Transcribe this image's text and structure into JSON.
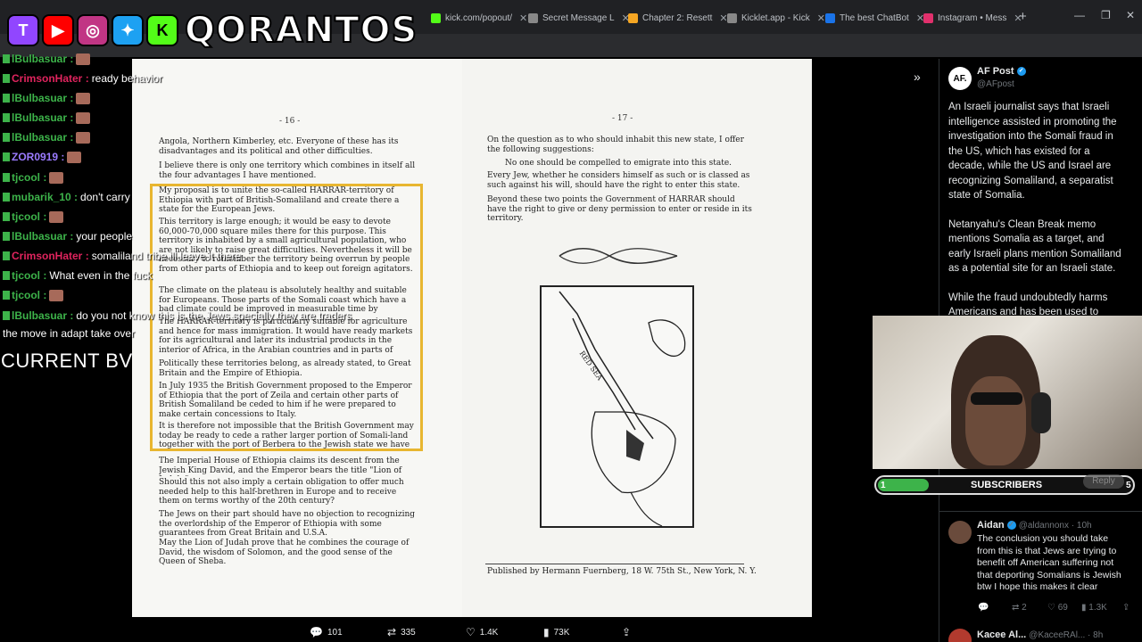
{
  "browser": {
    "tabs": [
      {
        "title": "kick.com/popout/",
        "color": "#53fc18"
      },
      {
        "title": "Secret Message L",
        "color": "#888888"
      },
      {
        "title": "Chapter 2: Resett",
        "color": "#f5a623"
      },
      {
        "title": "Kicklet.app - Kick",
        "color": "#888888"
      },
      {
        "title": "The best ChatBot",
        "color": "#1a73e8"
      },
      {
        "title": "Instagram • Mess",
        "color": "#e1306c"
      }
    ]
  },
  "overlay": {
    "logo_text": "QORANTOS",
    "logo_icons": [
      "twitch-icon",
      "youtube-icon",
      "instagram-icon",
      "twitter-icon",
      "kick-icon"
    ],
    "current_label": "CURRENT BV"
  },
  "chat": [
    {
      "user": "lBulbasuar :",
      "msg": "",
      "color": "#3db34a",
      "emote": true
    },
    {
      "user": "CrimsonHater :",
      "msg": "ready behavior",
      "color": "#e0245e",
      "emote": false
    },
    {
      "user": "lBulbasuar :",
      "msg": "",
      "color": "#3db34a",
      "emote": true
    },
    {
      "user": "lBulbasuar :",
      "msg": "",
      "color": "#3db34a",
      "emote": true
    },
    {
      "user": "lBulbasuar :",
      "msg": "",
      "color": "#3db34a",
      "emote": true
    },
    {
      "user": "ZOR0919 :",
      "msg": "",
      "color": "#9b7bff",
      "emote": true
    },
    {
      "user": "tjcool :",
      "msg": "",
      "color": "#3db34a",
      "emote": true
    },
    {
      "user": "mubarik_10 :",
      "msg": "don't carry",
      "color": "#3db34a",
      "emote": false
    },
    {
      "user": "tjcool :",
      "msg": "",
      "color": "#3db34a",
      "emote": true
    },
    {
      "user": "lBulbasuar :",
      "msg": "your people",
      "color": "#3db34a",
      "emote": false
    },
    {
      "user": "CrimsonHater :",
      "msg": "somaliland tribe ill leave it there",
      "color": "#e0245e",
      "emote": false
    },
    {
      "user": "tjcool :",
      "msg": "What even in the fuck",
      "color": "#3db34a",
      "emote": false
    },
    {
      "user": "tjcool :",
      "msg": "",
      "color": "#3db34a",
      "emote": true
    },
    {
      "user": "lBulbasuar :",
      "msg": "do you not know this is the Jews specially they are traders",
      "color": "#3db34a",
      "emote": false
    },
    {
      "user": "",
      "msg": "the move in adapt take over",
      "color": "#ffffff",
      "emote": false
    }
  ],
  "document": {
    "left_page_number": "- 16 -",
    "right_page_number": "- 17 -",
    "left_paragraphs": [
      "Angola, Northern Kimberley, etc. Everyone of these has its disadvantages and its political and other difficulties.",
      "I believe there is only one territory which combines in itself all the four advantages I have mentioned.",
      "My proposal is to unite the so-called HARRAR-territory of Ethiopia with part of British-Somaliland and create there a state for the European Jews.",
      "This territory is large enough; it would be easy to devote 60,000-70,000 square miles there for this purpose. This territory is inhabited by a small agricultural population, who are not likely to raise great difficulties. Nevertheless it will be necessary to remember the territory being overrun by people from other parts of Ethiopia and to keep out foreign agitators.",
      "The climate on the plateau is absolutely healthy and suitable for Europeans. Those parts of the Somali coast which have a bad climate could be improved in measurable time by irrigation.",
      "The HARRAR-territory is particularly suitable for agriculture and hence for mass immigration. It would have ready markets for its agricultural and later its industrial products in the interior of Africa, in the Arabian countries and in parts of India.",
      "Politically these territories belong, as already stated, to Great Britain and the Empire of Ethiopia.",
      "In July 1935 the British Government proposed to the Emperor of Ethiopia that the port of Zeila and certain other parts of British Somaliland be ceded to him if he were prepared to make certain concessions to Italy.",
      "It is therefore not impossible that the British Government may today be ready to cede a rather larger portion of Somali-land together with the port of Berbera to the Jewish state we have in mind.",
      "The Imperial House of Ethiopia claims its descent from the Jewish King David, and the Emperor bears the title \"Lion of Judah.\"",
      "Should this not also imply a certain obligation to offer much needed help to this half-brethren in Europe and to receive them on terms worthy of the 20th century?",
      "The Jews on their part should have no objection to recognizing the overlordship of the Emperor of Ethiopia with some guarantees from Great Britain and U.S.A.",
      "May the Lion of Judah prove that he combines the courage of David, the wisdom of Solomon, and the good sense of the Queen of Sheba."
    ],
    "right_paragraphs": [
      "On the question as to who should inhabit this new state, I offer the following suggestions:",
      "No one should be compelled to emigrate into this state.",
      "Every Jew, whether he considers himself as such or is classed as such against his will, should have the right to enter this state.",
      "Beyond these two points the Government of HARRAR should have the right to give or deny permission to enter or reside in its territory."
    ],
    "map_label": "RED SEA",
    "publisher": "Published by Hermann Fuernberg, 18 W. 75th St., New York, N. Y."
  },
  "tweet": {
    "author": "AF Post",
    "handle": "@AFpost",
    "avatar_text": "AF.",
    "paragraphs": [
      "An Israeli journalist says that Israeli intelligence assisted in promoting the investigation into the Somali fraud in the US, which has existed for a decade, while the US and Israel are recognizing Somaliland, a separatist state of Somalia.",
      "Netanyahu's Clean Break memo mentions Somalia as a target, and early Israeli plans mention Somaliland as a potential site for an Israeli state.",
      "While the fraud undoubtedly harms Americans and has been used to"
    ],
    "stats": {
      "replies": "101",
      "reposts": "335",
      "likes": "1.4K",
      "views": "73K"
    }
  },
  "subgoal": {
    "current": "1",
    "label": "SUBSCRIBERS",
    "goal": "5",
    "progress": 0.2,
    "reply_label": "Reply"
  },
  "reply": {
    "author": "Aidan",
    "handle": "@aldannonx · 10h",
    "text": "The conclusion you should take from this is that Jews are trying to benefit off American suffering not that deporting Somalians is Jewish btw I hope this makes it clear",
    "stats": {
      "replies": "",
      "reposts": "2",
      "likes": "69",
      "views": "1.3K"
    }
  },
  "reply2": {
    "author": "Kacee Al...",
    "handle": "@KaceeRAl... · 8h"
  }
}
